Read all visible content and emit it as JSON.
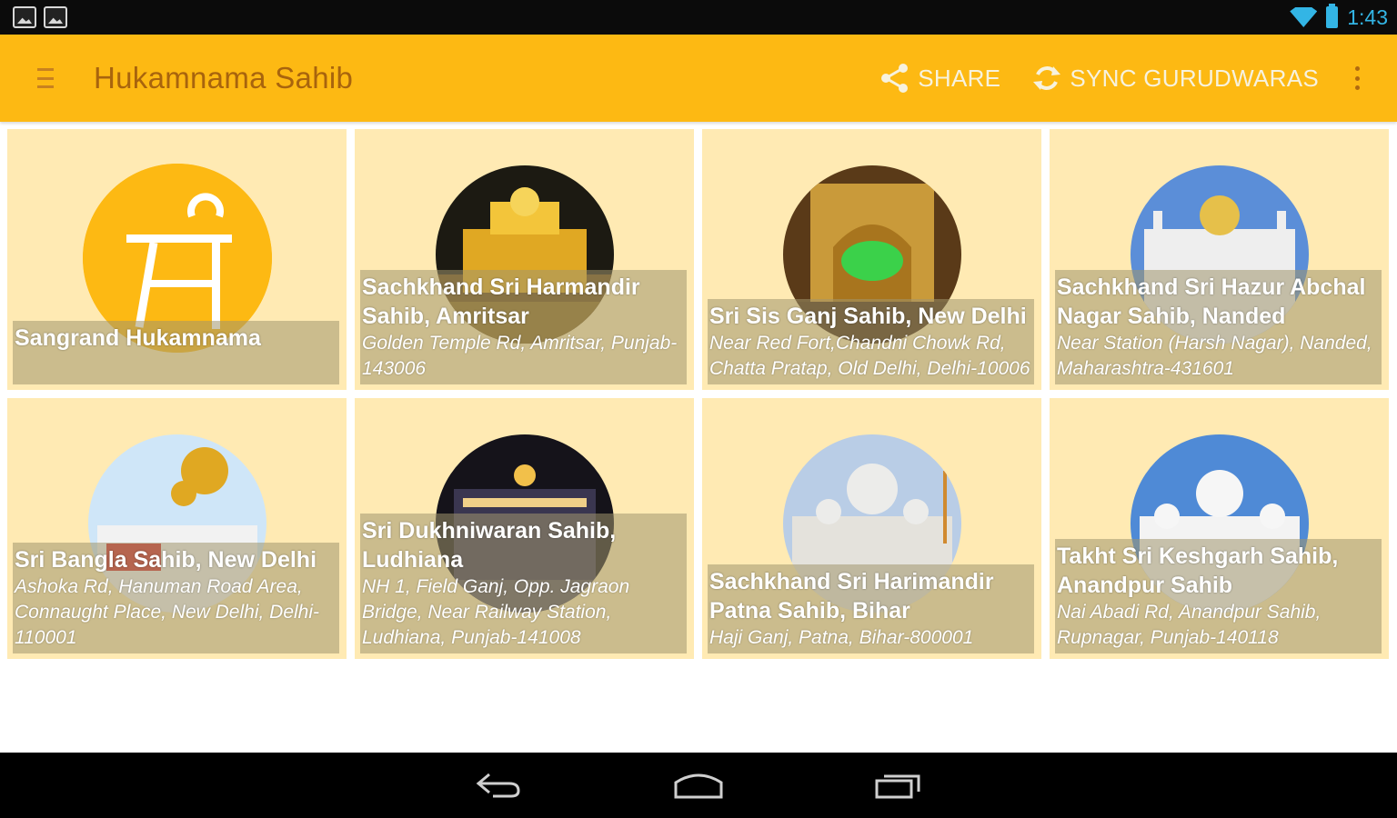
{
  "status_bar": {
    "time": "1:43"
  },
  "action_bar": {
    "title": "Hukamnama Sahib",
    "share_label": "SHARE",
    "sync_label": "SYNC GURUDWARAS"
  },
  "cards": [
    {
      "name": "Sangrand Hukamnama",
      "address": ""
    },
    {
      "name": "Sachkhand Sri Harmandir Sahib, Amritsar",
      "address": "Golden Temple Rd, Amritsar, Punjab-143006"
    },
    {
      "name": "Sri Sis Ganj Sahib, New Delhi",
      "address": "Near Red Fort,Chandni Chowk Rd, Chatta Pratap, Old Delhi, Delhi-10006"
    },
    {
      "name": "Sachkhand Sri Hazur Abchal Nagar Sahib, Nanded",
      "address": "Near Station (Harsh Nagar), Nanded, Maharashtra-431601"
    },
    {
      "name": "Sri Bangla Sahib, New Delhi",
      "address": "Ashoka Rd, Hanuman Road Area, Connaught Place, New Delhi, Delhi-110001"
    },
    {
      "name": "Sri Dukhniwaran Sahib, Ludhiana",
      "address": "NH 1, Field Ganj, Opp. Jagraon Bridge, Near Railway Station, Ludhiana, Punjab-141008"
    },
    {
      "name": "Sachkhand Sri Harimandir Patna Sahib, Bihar",
      "address": "Haji Ganj, Patna, Bihar-800001"
    },
    {
      "name": "Takht Sri Keshgarh Sahib, Anandpur Sahib",
      "address": "Nai Abadi Rd, Anandpur Sahib, Rupnagar, Punjab-140118"
    }
  ],
  "colors": {
    "action_bar": "#fdb913",
    "card_bg": "#ffeab3",
    "status_icon": "#33b5e5"
  },
  "icons": {
    "menu": "hamburger-icon",
    "share": "share-icon",
    "sync": "sync-icon",
    "overflow": "overflow-menu-icon",
    "back": "back-icon",
    "home": "home-icon",
    "recents": "recents-icon"
  }
}
